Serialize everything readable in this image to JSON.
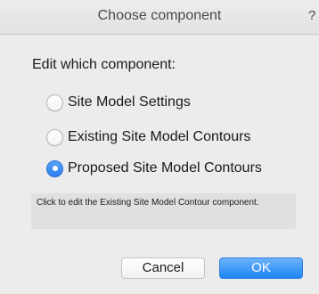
{
  "window": {
    "title": "Choose component",
    "help_glyph": "?"
  },
  "heading": "Edit which component:",
  "options": [
    {
      "label": "Site Model Settings",
      "checked": false
    },
    {
      "label": "Existing Site Model Contours",
      "checked": false
    },
    {
      "label": "Proposed Site Model Contours",
      "checked": true
    }
  ],
  "info_text": "Click to edit the Existing Site Model Contour component.",
  "buttons": {
    "cancel": "Cancel",
    "ok": "OK"
  },
  "colors": {
    "accent": "#2c7df0",
    "background": "#ececec"
  }
}
